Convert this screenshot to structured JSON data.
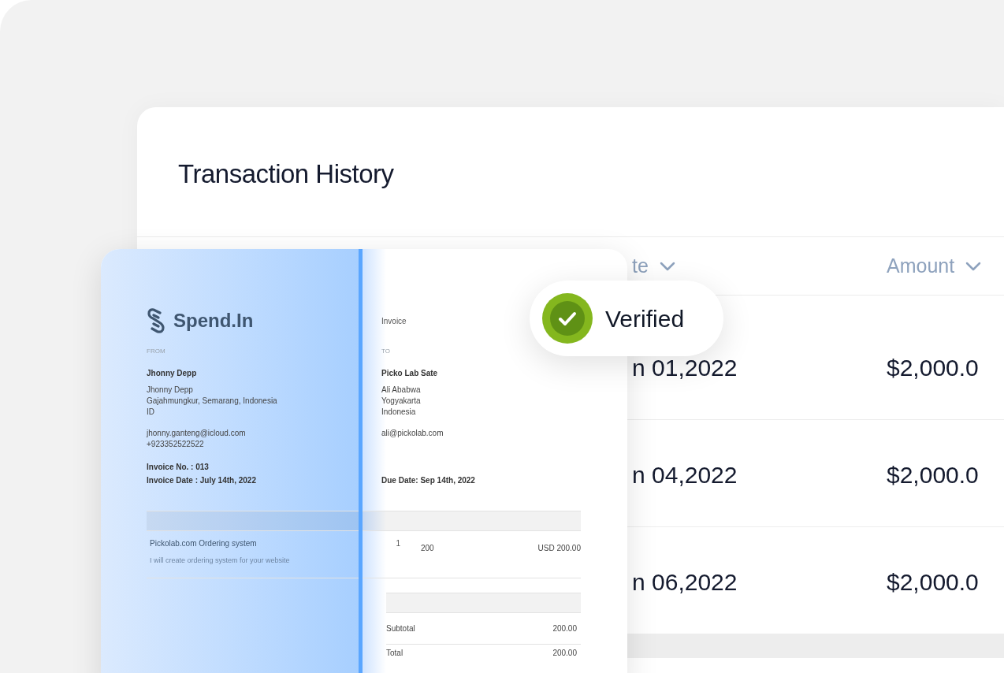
{
  "panel": {
    "title": "Transaction History",
    "columns": [
      {
        "label": "te"
      },
      {
        "label": "Amount"
      }
    ],
    "rows": [
      {
        "date": "n 01,2022",
        "amount": "$2,000.0"
      },
      {
        "date": "n 04,2022",
        "amount": "$2,000.0"
      },
      {
        "date": "n 06,2022",
        "amount": "$2,000.0"
      }
    ]
  },
  "invoice": {
    "brand": "Spend.In",
    "doc_label": "Invoice",
    "from": {
      "heading": "FROM",
      "name": "Jhonny Depp",
      "lines": [
        "Jhonny Depp",
        "Gajahmungkur, Semarang, Indonesia",
        "ID"
      ],
      "contact": [
        "jhonny.ganteng@icloud.com",
        "+923352522522"
      ],
      "meta": [
        "Invoice No. : 013",
        "Invoice Date : July 14th, 2022"
      ]
    },
    "to": {
      "heading": "TO",
      "name": "Picko Lab Sate",
      "lines": [
        "Ali Ababwa",
        "Yogyakarta",
        "Indonesia"
      ],
      "contact": [
        "ali@pickolab.com"
      ],
      "meta": [
        "Due Date: Sep 14th, 2022"
      ]
    },
    "items": [
      {
        "description": "Pickolab.com Ordering system",
        "note": "I will create ordering system for your website",
        "qty": "1",
        "rate": "200",
        "amount": "USD 200.00"
      }
    ],
    "summary": [
      {
        "label": "Subtotal",
        "value": "200.00"
      },
      {
        "label": "Total",
        "value": "200.00"
      }
    ]
  },
  "badge": {
    "label": "Verified"
  }
}
